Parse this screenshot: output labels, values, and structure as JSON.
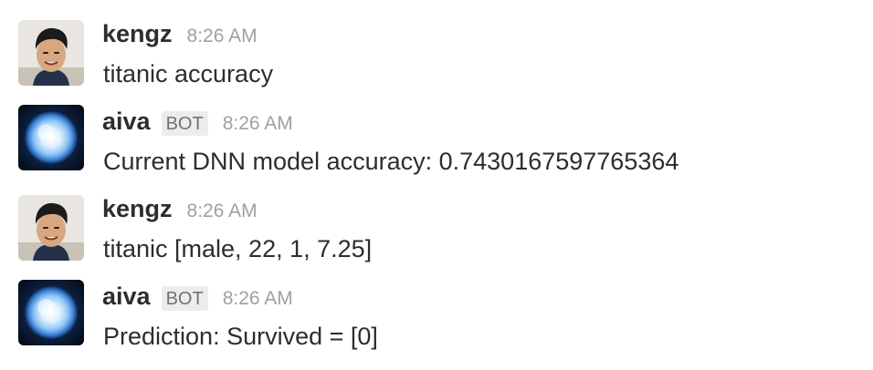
{
  "messages": [
    {
      "author": "kengz",
      "badge": "",
      "time": "8:26 AM",
      "text": "titanic accuracy",
      "avatar_icon": "user-photo-icon"
    },
    {
      "author": "aiva",
      "badge": "BOT",
      "time": "8:26 AM",
      "text": "Current DNN model accuracy: 0.7430167597765364",
      "avatar_icon": "blue-star-icon"
    },
    {
      "author": "kengz",
      "badge": "",
      "time": "8:26 AM",
      "text": "titanic [male, 22, 1, 7.25]",
      "avatar_icon": "user-photo-icon"
    },
    {
      "author": "aiva",
      "badge": "BOT",
      "time": "8:26 AM",
      "text": "Prediction: Survived = [0]",
      "avatar_icon": "blue-star-icon"
    }
  ],
  "colors": {
    "text": "#2c2d30",
    "timestamp": "#a0a0a2",
    "badge_bg": "#ececec",
    "badge_text": "#717274"
  }
}
